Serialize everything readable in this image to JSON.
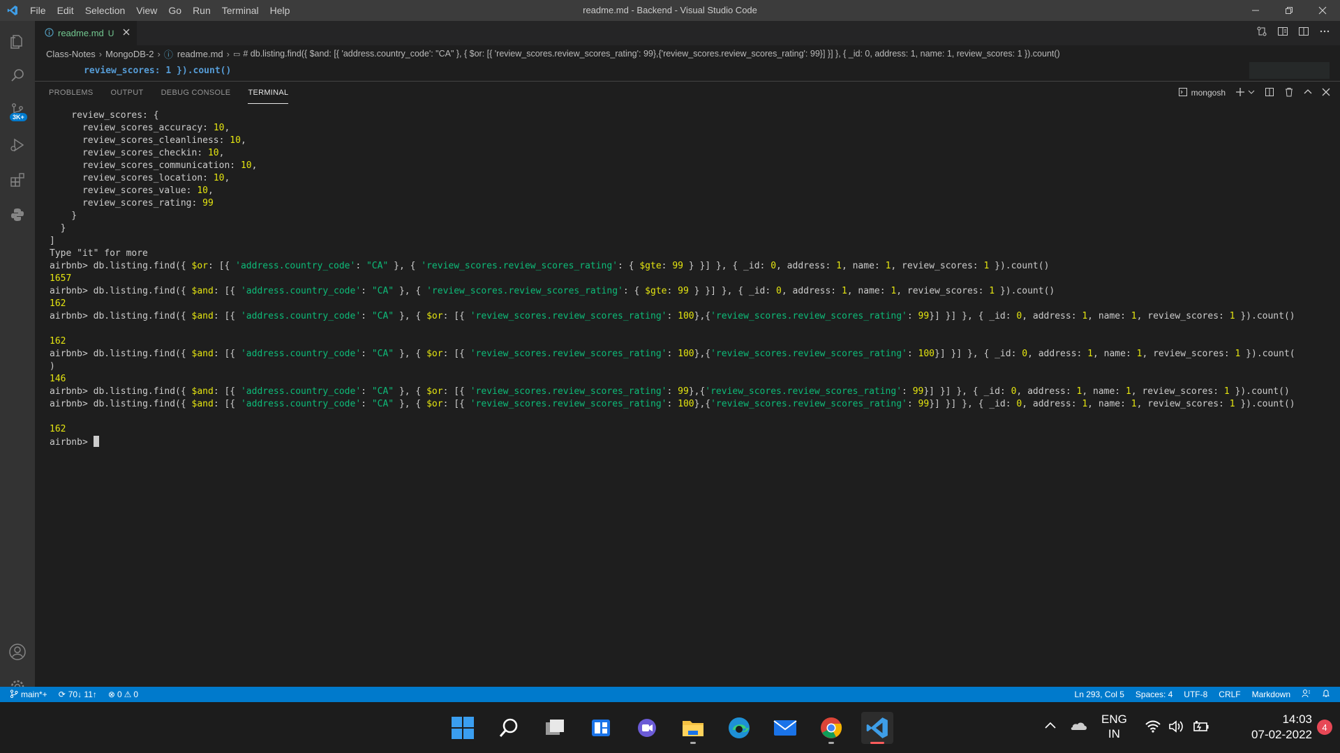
{
  "window": {
    "title": "readme.md - Backend - Visual Studio Code"
  },
  "menu": [
    "File",
    "Edit",
    "Selection",
    "View",
    "Go",
    "Run",
    "Terminal",
    "Help"
  ],
  "activity": {
    "badge": "3K+"
  },
  "tab": {
    "label": "readme.md",
    "status": "U"
  },
  "breadcrumb": {
    "items": [
      "Class-Notes",
      "MongoDB-2",
      "readme.md",
      "# db.listing.find({ $and: [{ 'address.country_code': \"CA\" }, { $or: [{ 'review_scores.review_scores_rating': 99},{'review_scores.review_scores_rating': 99}] }] }, { _id: 0, address: 1, name: 1, review_scores: 1 }).count()"
    ]
  },
  "editor": {
    "line": "review_scores: 1 }).count()"
  },
  "panel": {
    "tabs": [
      "PROBLEMS",
      "OUTPUT",
      "DEBUG CONSOLE",
      "TERMINAL"
    ],
    "active_tab": "TERMINAL",
    "terminal_name": "mongosh"
  },
  "terminal": {
    "review_header": "    review_scores: {",
    "scores": [
      {
        "key": "      review_scores_accuracy: ",
        "val": "10",
        "end": ","
      },
      {
        "key": "      review_scores_cleanliness: ",
        "val": "10",
        "end": ","
      },
      {
        "key": "      review_scores_checkin: ",
        "val": "10",
        "end": ","
      },
      {
        "key": "      review_scores_communication: ",
        "val": "10",
        "end": ","
      },
      {
        "key": "      review_scores_location: ",
        "val": "10",
        "end": ","
      },
      {
        "key": "      review_scores_value: ",
        "val": "10",
        "end": ","
      },
      {
        "key": "      review_scores_rating: ",
        "val": "99",
        "end": ""
      }
    ],
    "close1": "    }",
    "close2": "  }",
    "close3": "]",
    "type_it": "Type \"it\" for more",
    "prompt": "airbnb> ",
    "results": [
      "1657",
      "162",
      "162",
      "146",
      "162"
    ],
    "paren": ")"
  },
  "status": {
    "branch": "main*+",
    "sync": "70↓ 11↑",
    "errors": "0",
    "warnings": "0",
    "position": "Ln 293, Col 5",
    "spaces": "Spaces: 4",
    "encoding": "UTF-8",
    "eol": "CRLF",
    "language": "Markdown"
  },
  "taskbar": {
    "lang1": "ENG",
    "lang2": "IN",
    "time": "14:03",
    "date": "07-02-2022",
    "notif": "4"
  },
  "colors": {
    "statusbar": "#007acc",
    "accent": "#0078d4"
  }
}
